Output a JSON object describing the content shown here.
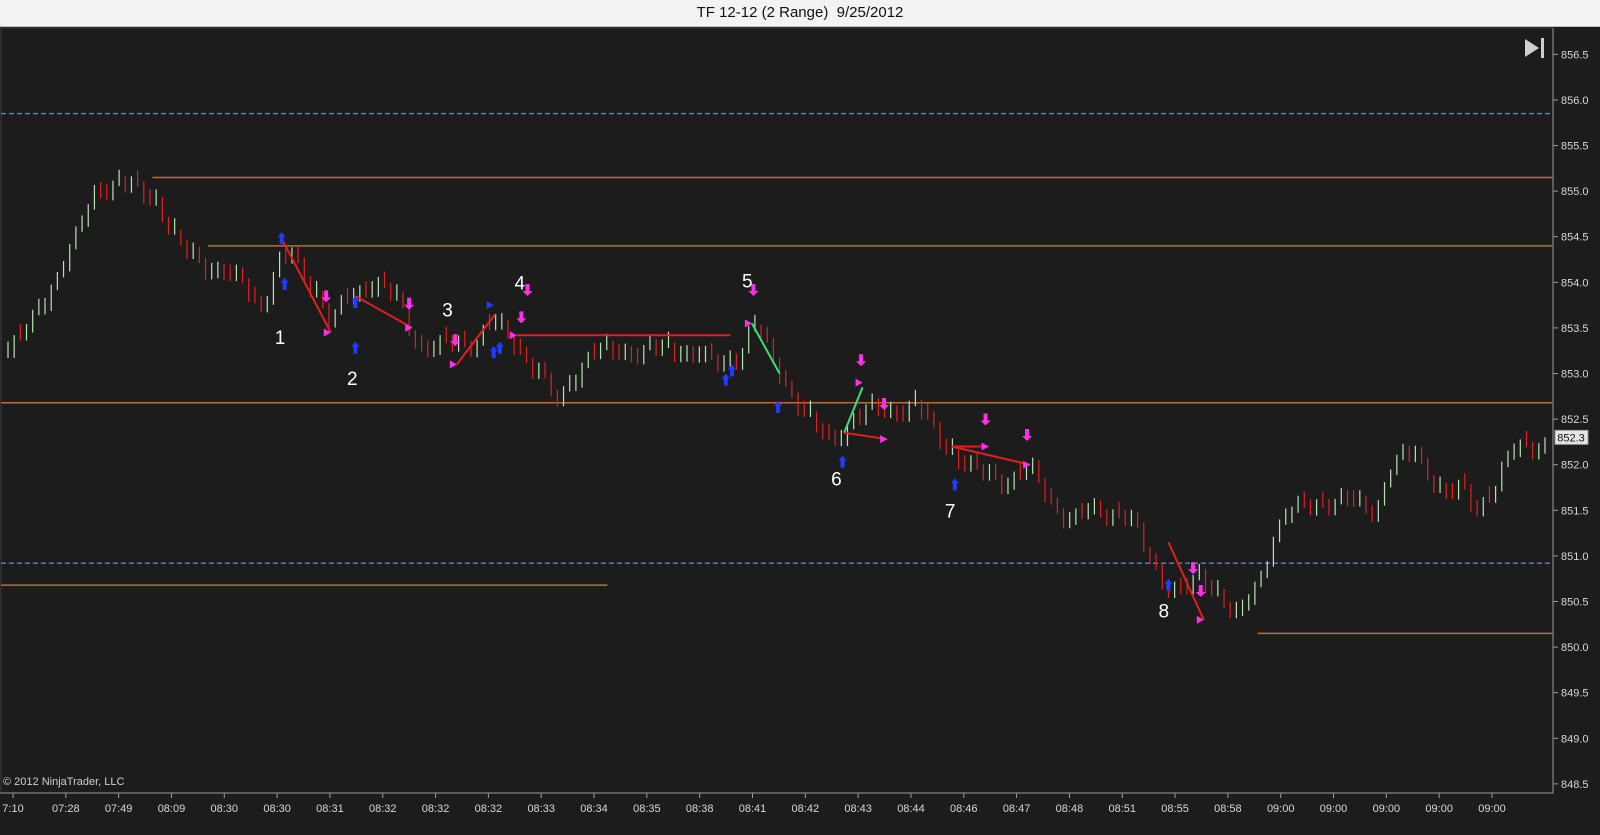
{
  "window": {
    "title": "TF 12-12 (2 Range)  9/25/2012"
  },
  "colors": {
    "background": "#1c1c1c",
    "up_bar": "#b7e3b1",
    "down_bar": "#e02020",
    "support_line": "#c0683a",
    "dashed_line": "#4f7fbf",
    "signal_magenta": "#ff30e8",
    "signal_blue": "#1f3cff",
    "trend_red": "#e02020",
    "trend_green": "#36e07a",
    "axis_text": "#d8d8d8"
  },
  "icons": {
    "scroll_end": "skip-to-end-icon"
  },
  "copyright": "© 2012 NinjaTrader, LLC",
  "current_price_label": "852.3",
  "chart_data": {
    "type": "ohlc-range-bar",
    "title": "TF 12-12 (2 Range)  9/25/2012",
    "ylim": [
      848.4,
      856.8
    ],
    "y_ticks": [
      "848.5",
      "849.0",
      "849.5",
      "850.0",
      "850.5",
      "851.0",
      "851.5",
      "852.0",
      "852.5",
      "853.0",
      "853.5",
      "854.0",
      "854.5",
      "855.0",
      "855.5",
      "856.0",
      "856.5"
    ],
    "x_ticks": [
      "7:10",
      "07:28",
      "07:49",
      "08:09",
      "08:30",
      "08:30",
      "08:31",
      "08:32",
      "08:32",
      "08:32",
      "08:33",
      "08:34",
      "08:35",
      "08:38",
      "08:41",
      "08:42",
      "08:43",
      "08:44",
      "08:46",
      "08:47",
      "08:48",
      "08:51",
      "08:55",
      "08:58",
      "09:00",
      "09:00",
      "09:00",
      "09:00",
      "09:00"
    ],
    "current_price": 852.3,
    "horizontal_lines": [
      {
        "style": "dashed",
        "price": 855.85,
        "x_start": 0,
        "x_end": 1
      },
      {
        "style": "solid",
        "price": 855.15,
        "x_start": 0.094,
        "x_end": 1
      },
      {
        "style": "solid",
        "price": 854.4,
        "x_start": 0.13,
        "x_end": 1
      },
      {
        "style": "solid",
        "price": 852.68,
        "x_start": 0,
        "x_end": 1
      },
      {
        "style": "dashed",
        "price": 850.92,
        "x_start": 0,
        "x_end": 1
      },
      {
        "style": "solid",
        "price": 850.68,
        "x_start": 0,
        "x_end": 0.39
      },
      {
        "style": "solid",
        "price": 850.15,
        "x_start": 0.813,
        "x_end": 1
      }
    ],
    "anchors": [
      [
        0,
        853.2
      ],
      [
        0.013,
        853.5
      ],
      [
        0.03,
        854.0
      ],
      [
        0.045,
        854.5
      ],
      [
        0.055,
        855.0
      ],
      [
        0.072,
        855.05
      ],
      [
        0.085,
        855.0
      ],
      [
        0.096,
        854.9
      ],
      [
        0.11,
        854.4
      ],
      [
        0.122,
        854.25
      ],
      [
        0.135,
        854.1
      ],
      [
        0.152,
        854.0
      ],
      [
        0.165,
        853.7
      ],
      [
        0.175,
        854.2
      ],
      [
        0.185,
        854.25
      ],
      [
        0.2,
        853.9
      ],
      [
        0.21,
        853.55
      ],
      [
        0.22,
        853.8
      ],
      [
        0.24,
        854.0
      ],
      [
        0.255,
        853.75
      ],
      [
        0.268,
        853.25
      ],
      [
        0.283,
        853.3
      ],
      [
        0.3,
        853.3
      ],
      [
        0.315,
        853.55
      ],
      [
        0.33,
        853.3
      ],
      [
        0.345,
        853.0
      ],
      [
        0.358,
        852.65
      ],
      [
        0.37,
        853.0
      ],
      [
        0.38,
        853.25
      ],
      [
        0.395,
        853.2
      ],
      [
        0.42,
        853.25
      ],
      [
        0.45,
        853.2
      ],
      [
        0.465,
        853.05
      ],
      [
        0.475,
        853.2
      ],
      [
        0.485,
        853.55
      ],
      [
        0.5,
        853.05
      ],
      [
        0.52,
        852.5
      ],
      [
        0.535,
        852.2
      ],
      [
        0.545,
        852.4
      ],
      [
        0.56,
        852.6
      ],
      [
        0.575,
        852.55
      ],
      [
        0.59,
        852.65
      ],
      [
        0.605,
        852.3
      ],
      [
        0.618,
        852.05
      ],
      [
        0.632,
        851.9
      ],
      [
        0.65,
        851.8
      ],
      [
        0.665,
        851.95
      ],
      [
        0.68,
        851.55
      ],
      [
        0.692,
        851.35
      ],
      [
        0.705,
        851.5
      ],
      [
        0.72,
        851.45
      ],
      [
        0.73,
        851.4
      ],
      [
        0.74,
        851.05
      ],
      [
        0.75,
        850.75
      ],
      [
        0.762,
        850.55
      ],
      [
        0.775,
        850.75
      ],
      [
        0.79,
        850.55
      ],
      [
        0.8,
        850.25
      ],
      [
        0.808,
        850.55
      ],
      [
        0.815,
        850.75
      ],
      [
        0.822,
        851.2
      ],
      [
        0.835,
        851.5
      ],
      [
        0.85,
        851.55
      ],
      [
        0.865,
        851.6
      ],
      [
        0.878,
        851.55
      ],
      [
        0.89,
        851.5
      ],
      [
        0.9,
        852.0
      ],
      [
        0.915,
        852.1
      ],
      [
        0.925,
        851.9
      ],
      [
        0.935,
        851.6
      ],
      [
        0.945,
        851.75
      ],
      [
        0.955,
        851.5
      ],
      [
        0.965,
        851.7
      ],
      [
        0.975,
        852.0
      ],
      [
        0.982,
        852.2
      ]
    ],
    "annotations": [
      {
        "label": "1",
        "x": 0.177,
        "price": 853.4
      },
      {
        "label": "2",
        "x": 0.224,
        "price": 852.95
      },
      {
        "label": "3",
        "x": 0.286,
        "price": 853.7
      },
      {
        "label": "4",
        "x": 0.333,
        "price": 854.0
      },
      {
        "label": "5",
        "x": 0.481,
        "price": 854.02
      },
      {
        "label": "6",
        "x": 0.539,
        "price": 851.85
      },
      {
        "label": "7",
        "x": 0.613,
        "price": 851.5
      },
      {
        "label": "8",
        "x": 0.752,
        "price": 850.4
      }
    ],
    "trend_segments": [
      {
        "color": "red",
        "from": [
          0.179,
          854.45
        ],
        "to": [
          0.21,
          853.45
        ]
      },
      {
        "color": "red",
        "from": [
          0.226,
          853.85
        ],
        "to": [
          0.263,
          853.5
        ]
      },
      {
        "color": "red",
        "from": [
          0.292,
          853.1
        ],
        "to": [
          0.317,
          853.65
        ]
      },
      {
        "color": "red",
        "from": [
          0.331,
          853.42
        ],
        "to": [
          0.47,
          853.42
        ]
      },
      {
        "color": "green",
        "from": [
          0.484,
          853.55
        ],
        "to": [
          0.502,
          853.0
        ]
      },
      {
        "color": "green",
        "from": [
          0.544,
          852.35
        ],
        "to": [
          0.556,
          852.85
        ]
      },
      {
        "color": "red",
        "from": [
          0.544,
          852.35
        ],
        "to": [
          0.572,
          852.28
        ]
      },
      {
        "color": "red",
        "from": [
          0.614,
          852.2
        ],
        "to": [
          0.638,
          852.2
        ]
      },
      {
        "color": "red",
        "from": [
          0.614,
          852.2
        ],
        "to": [
          0.665,
          852.0
        ]
      },
      {
        "color": "red",
        "from": [
          0.755,
          851.15
        ],
        "to": [
          0.778,
          850.3
        ]
      }
    ],
    "down_arrows": [
      [
        0.207,
        853.78
      ],
      [
        0.261,
        853.7
      ],
      [
        0.291,
        853.3
      ],
      [
        0.334,
        853.55
      ],
      [
        0.338,
        853.85
      ],
      [
        0.485,
        853.85
      ],
      [
        0.555,
        853.08
      ],
      [
        0.57,
        852.6
      ],
      [
        0.636,
        852.43
      ],
      [
        0.663,
        852.26
      ],
      [
        0.771,
        850.8
      ],
      [
        0.776,
        850.55
      ]
    ],
    "up_arrows": [
      [
        0.178,
        854.55
      ],
      [
        0.18,
        854.05
      ],
      [
        0.226,
        853.85
      ],
      [
        0.226,
        853.35
      ],
      [
        0.316,
        853.3
      ],
      [
        0.32,
        853.35
      ],
      [
        0.467,
        853.0
      ],
      [
        0.471,
        853.1
      ],
      [
        0.501,
        852.7
      ],
      [
        0.543,
        852.1
      ],
      [
        0.616,
        851.85
      ],
      [
        0.755,
        850.75
      ]
    ],
    "side_markers": [
      {
        "color": "magenta",
        "point": [
          0.21,
          853.45
        ]
      },
      {
        "color": "magenta",
        "point": [
          0.263,
          853.5
        ]
      },
      {
        "color": "magenta",
        "point": [
          0.292,
          853.1
        ]
      },
      {
        "color": "magenta",
        "point": [
          0.331,
          853.42
        ]
      },
      {
        "color": "magenta",
        "point": [
          0.484,
          853.55
        ]
      },
      {
        "color": "magenta",
        "point": [
          0.556,
          852.9
        ]
      },
      {
        "color": "magenta",
        "point": [
          0.572,
          852.28
        ]
      },
      {
        "color": "magenta",
        "point": [
          0.638,
          852.2
        ]
      },
      {
        "color": "magenta",
        "point": [
          0.665,
          852.0
        ]
      },
      {
        "color": "magenta",
        "point": [
          0.778,
          850.3
        ]
      },
      {
        "color": "blue",
        "point": [
          0.316,
          853.75
        ]
      }
    ]
  }
}
